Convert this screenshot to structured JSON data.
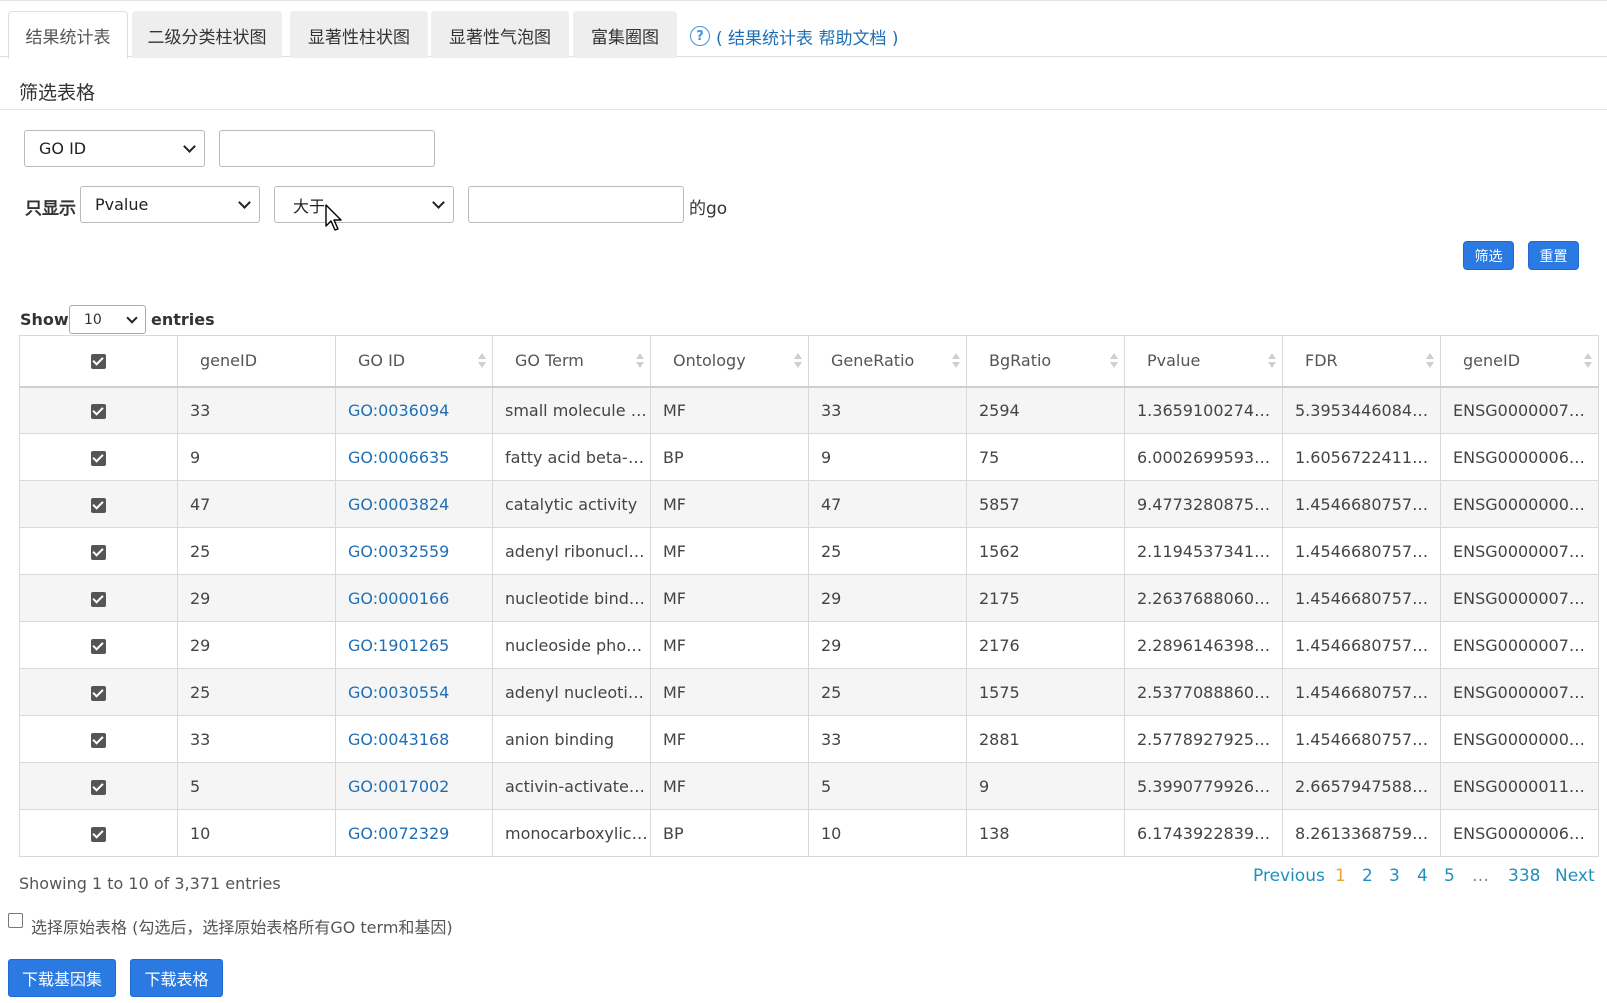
{
  "tabs": [
    {
      "label": "结果统计表"
    },
    {
      "label": "二级分类柱状图"
    },
    {
      "label": "显著性柱状图"
    },
    {
      "label": "显著性气泡图"
    },
    {
      "label": "富集圈图"
    }
  ],
  "help_link": "( 结果统计表 帮助文档 )",
  "help_icon_glyph": "?",
  "filter": {
    "title": "筛选表格",
    "field_select": "GO ID",
    "show_only_label": "只显示",
    "metric_select": "Pvalue",
    "operator_select": "大于",
    "suffix": "的go",
    "filter_button": "筛选",
    "reset_button": "重置"
  },
  "length": {
    "show_label": "Show",
    "value": "10",
    "entries_label": "entries"
  },
  "table": {
    "headers": [
      "geneID",
      "GO ID",
      "GO Term",
      "Ontology",
      "GeneRatio",
      "BgRatio",
      "Pvalue",
      "FDR",
      "geneID"
    ],
    "rows": [
      [
        "33",
        "GO:0036094",
        "small molecule binding",
        "MF",
        "33",
        "2594",
        "1.3659100274…",
        "5.3953446084…",
        "ENSG0000007…"
      ],
      [
        "9",
        "GO:0006635",
        "fatty acid beta-oxidation",
        "BP",
        "9",
        "75",
        "6.0002699593…",
        "1.6056722411…",
        "ENSG0000006…"
      ],
      [
        "47",
        "GO:0003824",
        "catalytic activity",
        "MF",
        "47",
        "5857",
        "9.4773280875…",
        "1.4546680757…",
        "ENSG0000000…"
      ],
      [
        "25",
        "GO:0032559",
        "adenyl ribonucleotide binding",
        "MF",
        "25",
        "1562",
        "2.1194537341…",
        "1.4546680757…",
        "ENSG0000007…"
      ],
      [
        "29",
        "GO:0000166",
        "nucleotide binding",
        "MF",
        "29",
        "2175",
        "2.2637688060…",
        "1.4546680757…",
        "ENSG0000007…"
      ],
      [
        "29",
        "GO:1901265",
        "nucleoside phosphate binding",
        "MF",
        "29",
        "2176",
        "2.2896146398…",
        "1.4546680757…",
        "ENSG0000007…"
      ],
      [
        "25",
        "GO:0030554",
        "adenyl nucleotide binding",
        "MF",
        "25",
        "1575",
        "2.5377088860…",
        "1.4546680757…",
        "ENSG0000007…"
      ],
      [
        "33",
        "GO:0043168",
        "anion binding",
        "MF",
        "33",
        "2881",
        "2.5778927925…",
        "1.4546680757…",
        "ENSG0000000…"
      ],
      [
        "5",
        "GO:0017002",
        "activin-activated receptor activity",
        "MF",
        "5",
        "9",
        "5.3990779926…",
        "2.6657947588…",
        "ENSG0000011…"
      ],
      [
        "10",
        "GO:0072329",
        "monocarboxylic acid catabolic process",
        "BP",
        "10",
        "138",
        "6.1743922839…",
        "8.2613368759…",
        "ENSG0000006…"
      ]
    ]
  },
  "info_text": "Showing 1 to 10 of 3,371 entries",
  "pagination": {
    "previous": "Previous",
    "pages": [
      "1",
      "2",
      "3",
      "4",
      "5"
    ],
    "ellipsis": "…",
    "last": "338",
    "next": "Next"
  },
  "original_table_label": "选择原始表格 (勾选后，选择原始表格所有GO term和基因)",
  "buttons": {
    "download_genes": "下载基因集",
    "download_table": "下载表格"
  },
  "colors": {
    "primary": "#2a7ae2",
    "link": "#1f6fb5",
    "current_page": "#f0a030"
  }
}
